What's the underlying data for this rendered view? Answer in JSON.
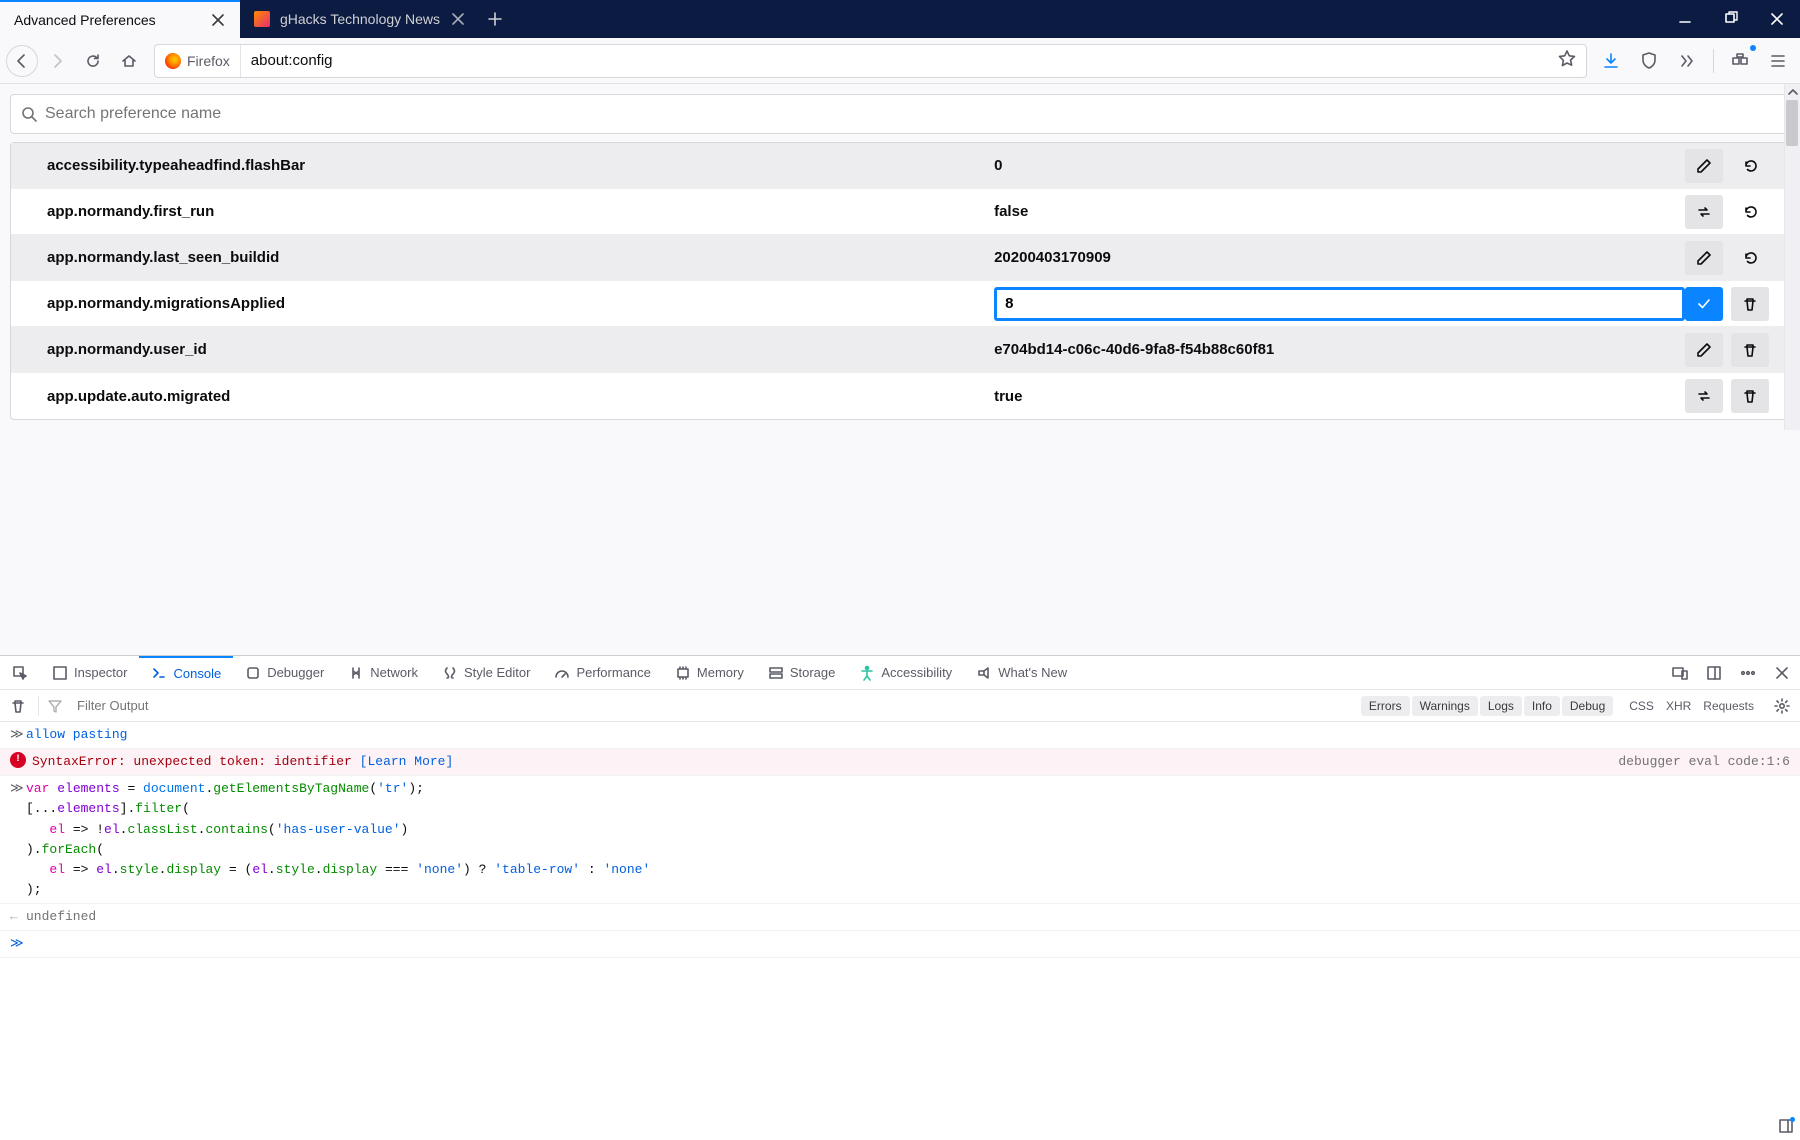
{
  "tabs": {
    "active_title": "Advanced Preferences",
    "inactive_title": "gHacks Technology News"
  },
  "urlbar": {
    "identity_label": "Firefox",
    "url": "about:config"
  },
  "search": {
    "placeholder": "Search preference name"
  },
  "prefs": [
    {
      "name": "accessibility.typeaheadfind.flashBar",
      "value": "0",
      "actions": [
        "edit",
        "reset"
      ],
      "editing": false
    },
    {
      "name": "app.normandy.first_run",
      "value": "false",
      "actions": [
        "toggle",
        "reset"
      ],
      "editing": false
    },
    {
      "name": "app.normandy.last_seen_buildid",
      "value": "20200403170909",
      "actions": [
        "edit",
        "reset"
      ],
      "editing": false
    },
    {
      "name": "app.normandy.migrationsApplied",
      "value": "8",
      "actions": [
        "save",
        "delete"
      ],
      "editing": true
    },
    {
      "name": "app.normandy.user_id",
      "value": "e704bd14-c06c-40d6-9fa8-f54b88c60f81",
      "actions": [
        "edit",
        "delete"
      ],
      "editing": false
    },
    {
      "name": "app.update.auto.migrated",
      "value": "true",
      "actions": [
        "toggle",
        "delete"
      ],
      "editing": false
    }
  ],
  "devtools": {
    "tabs": [
      "Inspector",
      "Console",
      "Debugger",
      "Network",
      "Style Editor",
      "Performance",
      "Memory",
      "Storage",
      "Accessibility",
      "What's New"
    ],
    "active_tab": "Console",
    "filter_placeholder": "Filter Output",
    "categories": [
      "Errors",
      "Warnings",
      "Logs",
      "Info",
      "Debug"
    ],
    "modes": [
      "CSS",
      "XHR",
      "Requests"
    ]
  },
  "console": {
    "line1": "allow pasting",
    "error_msg": "SyntaxError: unexpected token: identifier",
    "error_link": "[Learn More]",
    "error_loc": "debugger eval code:1:6",
    "out": "undefined",
    "code": {
      "l1_kw": "var",
      "l1_var": "elements",
      "l1_op": " = ",
      "l1_doc": "document",
      "l1_dot1": ".",
      "l1_fn": "getElementsByTagName",
      "l1_paren": "(",
      "l1_str": "'tr'",
      "l1_end": ");",
      "l2": "[...",
      "l2_var": "elements",
      "l2_end": "].",
      "l2_fn": "filter",
      "l2_p": "(",
      "l3_pad": "   ",
      "l3_arg": "el",
      "l3_arr": " => !",
      "l3_el": "el",
      "l3_dot": ".",
      "l3_cl": "classList",
      "l3_dot2": ".",
      "l3_cont": "contains",
      "l3_p": "(",
      "l3_str": "'has-user-value'",
      "l3_end": ")",
      "l4": ").",
      "l4_fn": "forEach",
      "l4_p": "(",
      "l5_pad": "   ",
      "l5_arg": "el",
      "l5_arr": " => ",
      "l5_el": "el",
      "l5_d1": ".",
      "l5_st": "style",
      "l5_d2": ".",
      "l5_dp": "display",
      "l5_eq": " = (",
      "l5_el2": "el",
      "l5_d3": ".",
      "l5_st2": "style",
      "l5_d4": ".",
      "l5_dp2": "display",
      "l5_cmp": " === ",
      "l5_none": "'none'",
      "l5_q": ") ? ",
      "l5_tr": "'table-row'",
      "l5_col": " : ",
      "l5_none2": "'none'",
      "l6": ");"
    }
  }
}
